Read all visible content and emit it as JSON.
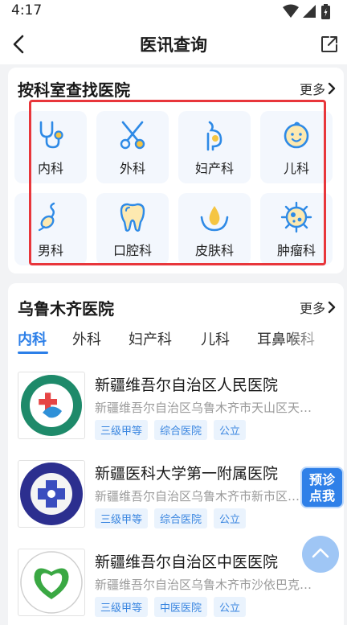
{
  "status_bar": {
    "time": "4:17"
  },
  "nav": {
    "title": "医讯查询"
  },
  "department_section": {
    "title": "按科室查找医院",
    "more": "更多",
    "departments": [
      {
        "label": "内科",
        "icon": "stethoscope-icon"
      },
      {
        "label": "外科",
        "icon": "scissors-icon"
      },
      {
        "label": "妇产科",
        "icon": "pregnant-icon"
      },
      {
        "label": "儿科",
        "icon": "baby-icon"
      },
      {
        "label": "男科",
        "icon": "sperm-icon"
      },
      {
        "label": "口腔科",
        "icon": "tooth-icon"
      },
      {
        "label": "皮肤科",
        "icon": "skin-drop-icon"
      },
      {
        "label": "肿瘤科",
        "icon": "tumor-cell-icon"
      }
    ]
  },
  "hospital_section": {
    "title": "乌鲁木齐医院",
    "more": "更多",
    "tabs": [
      {
        "label": "内科",
        "active": true
      },
      {
        "label": "外科",
        "active": false
      },
      {
        "label": "妇产科",
        "active": false
      },
      {
        "label": "儿科",
        "active": false
      },
      {
        "label": "耳鼻喉科",
        "active": false
      }
    ],
    "hospitals": [
      {
        "name": "新疆维吾尔自治区人民医院",
        "address": "新疆维吾尔自治区乌鲁木齐市天山区天…",
        "tags": [
          "三级甲等",
          "综合医院",
          "公立"
        ]
      },
      {
        "name": "新疆医科大学第一附属医院",
        "address": "新疆维吾尔自治区乌鲁木齐市新市区…",
        "tags": [
          "三级甲等",
          "综合医院",
          "公立"
        ]
      },
      {
        "name": "新疆维吾尔自治区中医医院",
        "address": "新疆维吾尔自治区乌鲁木齐市沙依巴克…",
        "tags": [
          "三级甲等",
          "中医医院",
          "公立"
        ]
      }
    ]
  },
  "floating": {
    "prediagnosis_line1": "预诊",
    "prediagnosis_line2": "点我"
  },
  "colors": {
    "accent": "#2c7fe8",
    "highlight_border": "#e8363b",
    "tag_text": "#3a86e0"
  }
}
